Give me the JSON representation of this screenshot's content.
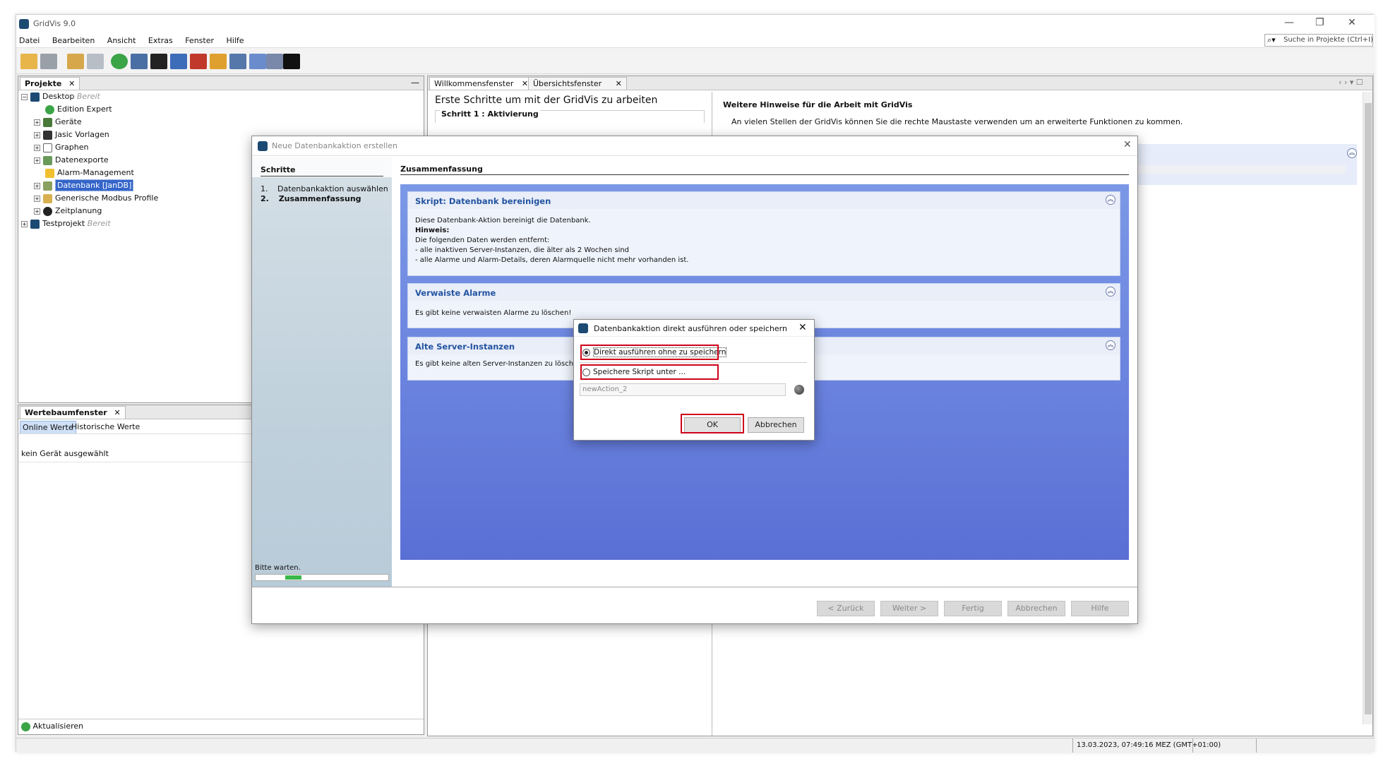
{
  "window": {
    "title": "GridVis 9.0",
    "controls": {
      "minimize": "—",
      "maximize": "❐",
      "close": "✕"
    }
  },
  "menu": [
    "Datei",
    "Bearbeiten",
    "Ansicht",
    "Extras",
    "Fenster",
    "Hilfe"
  ],
  "search": {
    "placeholder": "Suche in Projekte (Ctrl+I)"
  },
  "projects_panel": {
    "tab_label": "Projekte",
    "tree": [
      {
        "label": "Desktop",
        "status": "Bereit"
      },
      {
        "label": "Edition Expert"
      },
      {
        "label": "Geräte"
      },
      {
        "label": "Jasic Vorlagen"
      },
      {
        "label": "Graphen"
      },
      {
        "label": "Datenexporte"
      },
      {
        "label": "Alarm-Management"
      },
      {
        "label": "Datenbank [JanDB]"
      },
      {
        "label": "Generische Modbus Profile"
      },
      {
        "label": "Zeitplanung"
      },
      {
        "label": "Testprojekt",
        "status": "Bereit"
      }
    ]
  },
  "values_panel": {
    "tab_label": "Wertebaumfenster",
    "subtabs": [
      "Online Werte",
      "Historische Werte"
    ],
    "empty_text": "kein Gerät ausgewählt",
    "refresh_label": "Aktualisieren"
  },
  "editor_tabs": [
    "Willkommensfenster",
    "Übersichtsfenster"
  ],
  "welcome": {
    "heading": "Erste Schritte um mit der GridVis zu arbeiten",
    "step_label": "Schritt 1 : Aktivierung",
    "hints_heading": "Weitere Hinweise für die Arbeit mit GridVis",
    "hints_text": "An vielen Stellen der GridVis können Sie die rechte Maustaste verwenden um an erweiterte Funktionen zu kommen."
  },
  "wizard": {
    "title": "Neue Datenbankaktion erstellen",
    "steps_heading": "Schritte",
    "steps": [
      {
        "num": "1.",
        "label": "Datenbankaktion auswählen"
      },
      {
        "num": "2.",
        "label": "Zusammenfassung"
      }
    ],
    "wait_label": "Bitte warten.",
    "progress": 0.12,
    "summary_heading": "Zusammenfassung",
    "sections": [
      {
        "title": "Skript: Datenbank bereinigen",
        "lines": [
          "Diese Datenbank-Aktion bereinigt die Datenbank.",
          "Hinweis:",
          "Die folgenden Daten werden entfernt:",
          "- alle inaktiven Server-Instanzen, die älter als 2 Wochen sind",
          "- alle Alarme und Alarm-Details, deren Alarmquelle nicht mehr vorhanden ist."
        ]
      },
      {
        "title": "Verwaiste Alarme",
        "lines": [
          "Es gibt keine verwaisten Alarme zu löschen!"
        ]
      },
      {
        "title": "Alte Server-Instanzen",
        "lines": [
          "Es gibt keine alten Server-Instanzen zu löschen!"
        ]
      }
    ],
    "buttons": [
      "< Zurück",
      "Weiter >",
      "Fertig",
      "Abbrechen",
      "Hilfe"
    ]
  },
  "modal": {
    "title": "Datenbankaktion direkt ausführen oder speichern",
    "option_direct": "Direkt ausführen ohne zu speichern",
    "option_save": "Speichere Skript unter ...",
    "script_name": "newAction_2",
    "ok_label": "OK",
    "cancel_label": "Abbrechen"
  },
  "statusbar": {
    "datetime": "13.03.2023, 07:49:16 MEZ (GMT+01:00)"
  },
  "colors": {
    "wizard_gradient_top": "#6f8fe0",
    "wizard_gradient_bottom": "#5b6fd6",
    "section_title": "#2454a0",
    "highlight": "#3465c9",
    "annotation_red": "#d0021b"
  }
}
